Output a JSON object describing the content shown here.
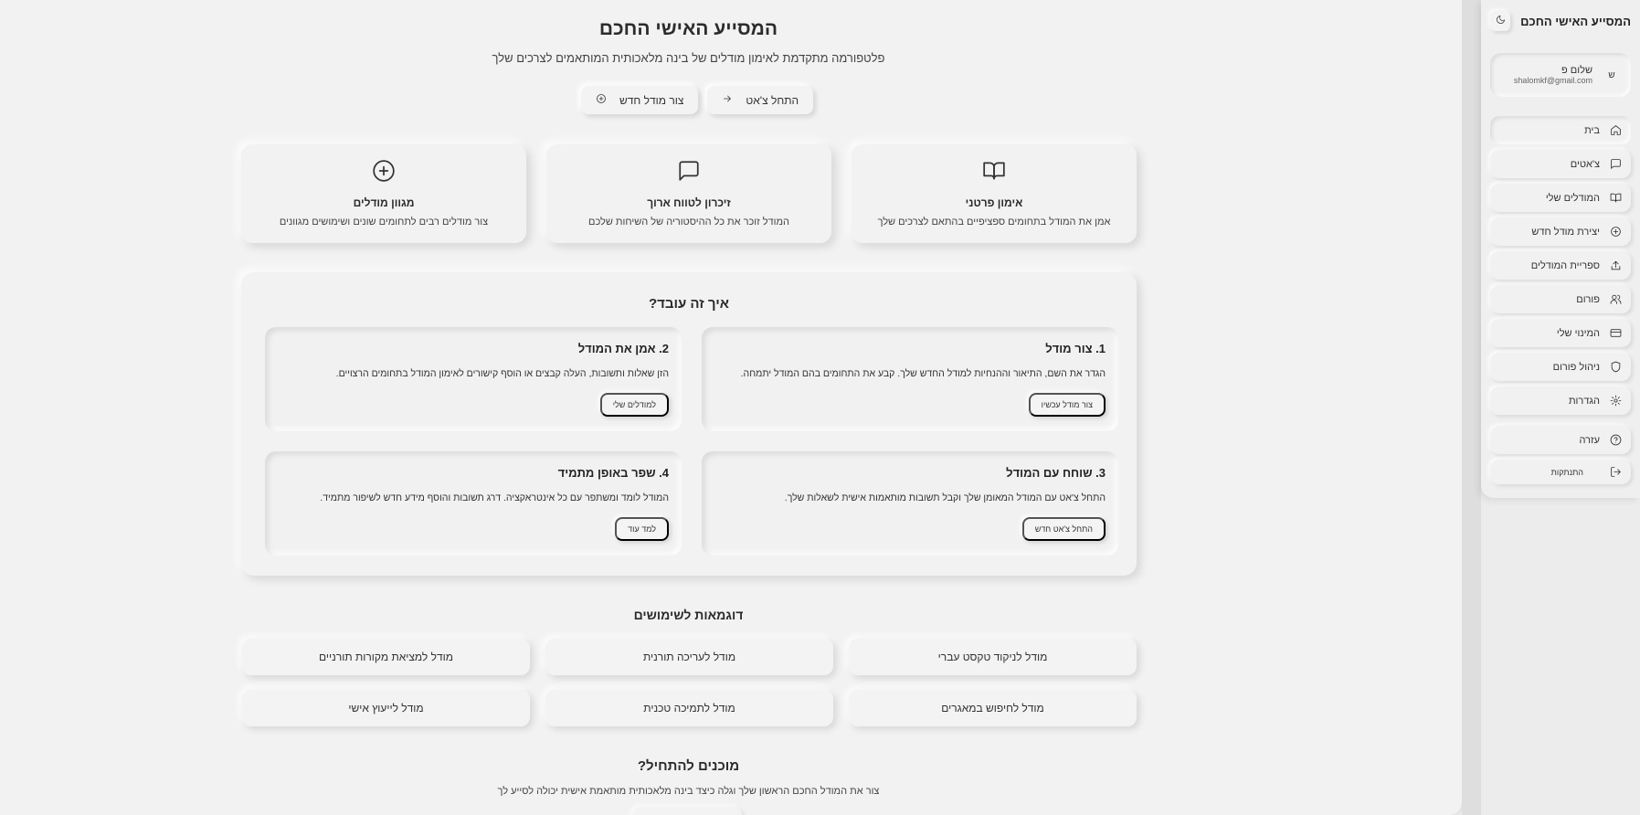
{
  "app": {
    "title": "המסייע האישי החכם"
  },
  "user": {
    "initial": "ש",
    "name": "שלום פ",
    "email": "shalomkf@gmail.com"
  },
  "sidebar": {
    "items": [
      {
        "label": "בית",
        "icon": "home-icon"
      },
      {
        "label": "צ'אטים",
        "icon": "chat-icon"
      },
      {
        "label": "המודלים שלי",
        "icon": "book-icon"
      },
      {
        "label": "יצירת מודל חדש",
        "icon": "plus-circle-icon"
      },
      {
        "label": "ספריית המודלים",
        "icon": "share-icon"
      },
      {
        "label": "פורום",
        "icon": "users-icon"
      },
      {
        "label": "המינוי שלי",
        "icon": "credit-card-icon"
      },
      {
        "label": "ניהול פורום",
        "icon": "shield-icon"
      },
      {
        "label": "הגדרות",
        "icon": "gear-icon"
      },
      {
        "label": "עזרה",
        "icon": "help-icon"
      },
      {
        "label": "התנתקות",
        "icon": "logout-icon"
      }
    ]
  },
  "hero": {
    "title": "המסייע האישי החכם",
    "subtitle": "פלטפורמה מתקדמת לאימון מודלים של בינה מלאכותית המותאמים לצרכים שלך",
    "start_chat": "התחל צ'אט",
    "create_model": "צור מודל חדש"
  },
  "features": [
    {
      "title": "אימון פרטני",
      "desc": "אמן את המודל בתחומים ספציפיים בהתאם לצרכים שלך",
      "icon": "book-open-icon"
    },
    {
      "title": "זיכרון לטווח ארוך",
      "desc": "המודל זוכר את כל ההיסטוריה של השיחות שלכם",
      "icon": "message-icon"
    },
    {
      "title": "מגוון מודלים",
      "desc": "צור מודלים רבים לתחומים שונים ושימושים מגוונים",
      "icon": "plus-circle-icon"
    }
  ],
  "how": {
    "title": "איך זה עובד?",
    "steps": [
      {
        "title": "1. צור מודל",
        "desc": "הגדר את השם, התיאור וההנחיות למודל החדש שלך. קבע את התחומים בהם המודל יתמחה.",
        "button": "צור מודל עכשיו"
      },
      {
        "title": "2. אמן את המודל",
        "desc": "הזן שאלות ותשובות, העלה קבצים או הוסף קישורים לאימון המודל בתחומים הרצויים.",
        "button": "למודלים שלי"
      },
      {
        "title": "3. שוחח עם המודל",
        "desc": "התחל צ'אט עם המודל המאומן שלך וקבל תשובות מותאמות אישית לשאלות שלך.",
        "button": "התחל צ'אט חדש"
      },
      {
        "title": "4. שפר באופן מתמיד",
        "desc": "המודל לומד ומשתפר עם כל אינטראקציה. דרג תשובות והוסף מידע חדש לשיפור מתמיד.",
        "button": "למד עוד"
      }
    ]
  },
  "examples": {
    "title": "דוגמאות לשימושים",
    "items": [
      "מודל לניקוד טקסט עברי",
      "מודל לעריכה תורנית",
      "מודל למציאת מקורות תורניים",
      "מודל לחיפוש במאגרים",
      "מודל לתמיכה טכנית",
      "מודל לייעוץ אישי"
    ]
  },
  "cta": {
    "title": "מוכנים להתחיל?",
    "subtitle": "צור את המודל החכם הראשון שלך וגלה כיצד בינה מלאכותית מותאמת אישית יכולה לסייע לך"
  }
}
